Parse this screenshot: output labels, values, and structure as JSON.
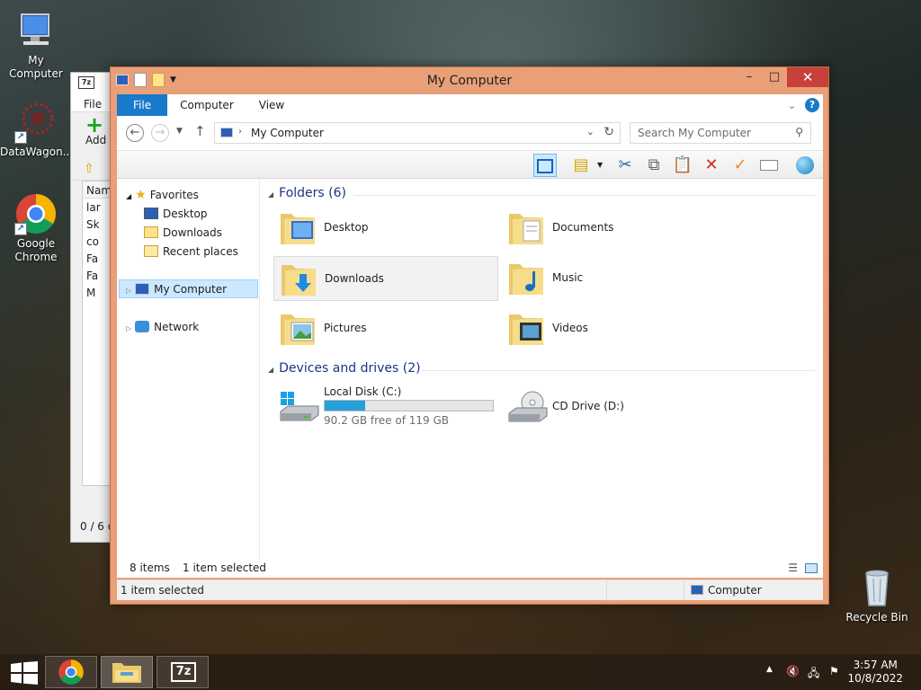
{
  "desktop": {
    "icons": [
      {
        "label": "My Computer"
      },
      {
        "label": "DataWagon..."
      },
      {
        "label": "Google Chrome"
      },
      {
        "label": "Recycle Bin"
      }
    ]
  },
  "zip_window": {
    "menu_file": "File",
    "add_label": "Add",
    "col_name": "Name",
    "rows": [
      "lar",
      "Sk",
      "co",
      "Fa",
      "Fa",
      "M"
    ],
    "status": "0 / 6 o"
  },
  "window": {
    "title": "My Computer",
    "tabs": {
      "file": "File",
      "computer": "Computer",
      "view": "View"
    },
    "help": "?",
    "address": "My Computer",
    "search_placeholder": "Search My Computer"
  },
  "nav_pane": {
    "favorites": "Favorites",
    "desktop": "Desktop",
    "downloads": "Downloads",
    "recent": "Recent places",
    "my_computer": "My Computer",
    "network": "Network"
  },
  "main": {
    "folders_header": "Folders (6)",
    "folders": [
      {
        "name": "Desktop",
        "icon": "desktop-folder"
      },
      {
        "name": "Documents",
        "icon": "documents-folder"
      },
      {
        "name": "Downloads",
        "icon": "downloads-folder"
      },
      {
        "name": "Music",
        "icon": "music-folder"
      },
      {
        "name": "Pictures",
        "icon": "pictures-folder"
      },
      {
        "name": "Videos",
        "icon": "videos-folder"
      }
    ],
    "devices_header": "Devices and drives (2)",
    "drives": [
      {
        "name": "Local Disk (C:)",
        "free_text": "90.2 GB free of 119 GB",
        "used_fraction": 0.24
      },
      {
        "name": "CD Drive (D:)"
      }
    ]
  },
  "item_bar": {
    "count": "8 items",
    "selected": "1 item selected"
  },
  "status_bar": {
    "left": "1 item selected",
    "right": "Computer"
  },
  "taskbar": {
    "time": "3:57 AM",
    "date": "10/8/2022"
  },
  "colors": {
    "accent": "#1979ca",
    "titlebar": "#e99f78",
    "close": "#c7403a",
    "drive_fill": "#26a0da"
  }
}
